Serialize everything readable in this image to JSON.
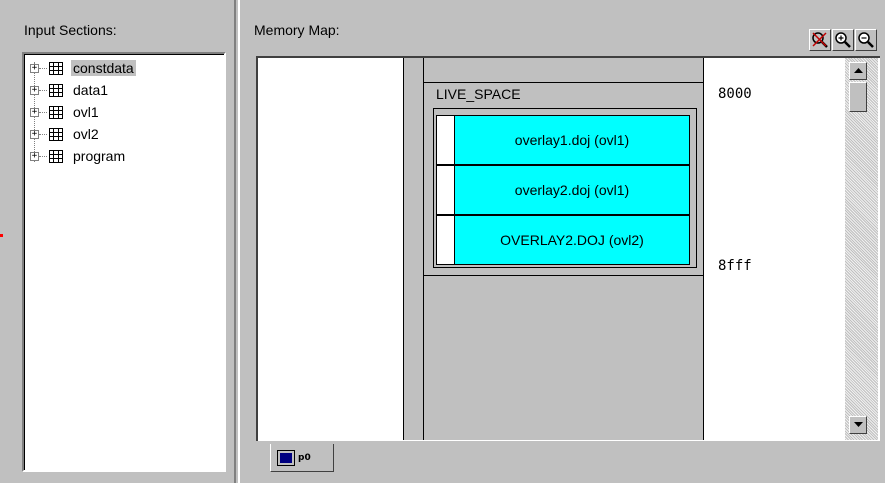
{
  "left_panel": {
    "title": "Input Sections:",
    "items": [
      {
        "label": "constdata",
        "selected": true,
        "expander": "+"
      },
      {
        "label": "data1",
        "selected": false,
        "expander": "+"
      },
      {
        "label": "ovl1",
        "selected": false,
        "expander": "+"
      },
      {
        "label": "ovl2",
        "selected": false,
        "expander": "+"
      },
      {
        "label": "program",
        "selected": false,
        "expander": "+"
      }
    ]
  },
  "right_panel": {
    "title": "Memory Map:",
    "zoom_buttons": [
      "zoom-reset-icon",
      "zoom-in-icon",
      "zoom-out-icon"
    ],
    "space_label": "LIVE_SPACE",
    "start_address": "8000",
    "end_address": "8fff",
    "overlays": [
      {
        "label": "overlay1.doj (ovl1)"
      },
      {
        "label": "overlay2.doj (ovl1)"
      },
      {
        "label": "OVERLAY2.DOJ (ovl2)"
      }
    ],
    "tab_label": "p0"
  },
  "colors": {
    "overlay_fill": "#00ffff",
    "background": "#c0c0c0",
    "tab_icon": "#000080"
  }
}
